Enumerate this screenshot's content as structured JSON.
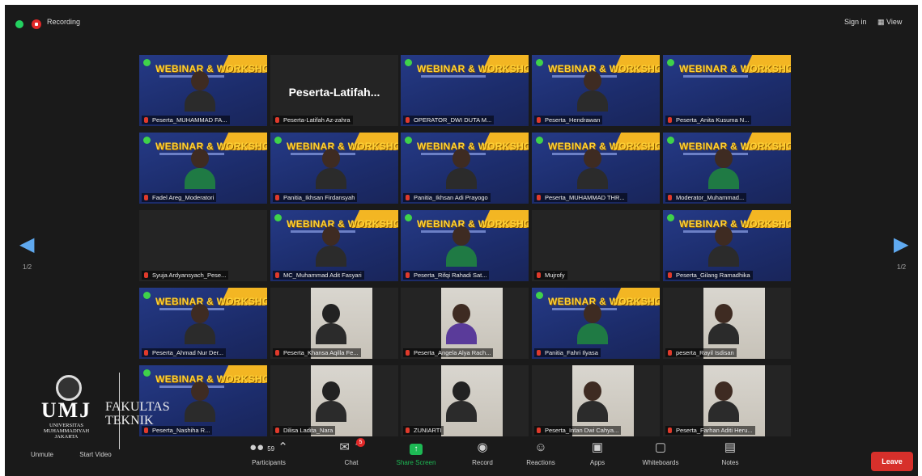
{
  "topbar": {
    "recording_label": "Recording",
    "sign_in": "Sign in",
    "view": "View"
  },
  "webinar_banner": "WEBINAR & WORKSHOP",
  "tiles": [
    {
      "name": "Peserta_MUHAMMAD FA...",
      "type": "webinar",
      "shirt": "dark"
    },
    {
      "name": "Peserta-Latifah Az-zahra",
      "type": "name",
      "big": "Peserta-Latifah..."
    },
    {
      "name": "OPERATOR_DWI DUTA M...",
      "type": "webinar",
      "shirt": "none"
    },
    {
      "name": "Peserta_Hendrawan",
      "type": "webinar",
      "shirt": "dark"
    },
    {
      "name": "Peserta_Anita Kusuma N...",
      "type": "webinar",
      "shirt": "none"
    },
    {
      "name": "Fadel Areg_Moderatori",
      "type": "webinar",
      "shirt": "green"
    },
    {
      "name": "Panitia_Ikhsan Firdansyah",
      "type": "webinar",
      "shirt": "dark"
    },
    {
      "name": "Panitia_Ikhsan Adi Prayogo",
      "type": "webinar",
      "shirt": "dark"
    },
    {
      "name": "Peserta_MUHAMMAD THR...",
      "type": "webinar",
      "shirt": "dark"
    },
    {
      "name": "Moderator_Muhammad...",
      "type": "webinar",
      "shirt": "green"
    },
    {
      "name": "Syuja Ardyansyach_Pese...",
      "type": "empty"
    },
    {
      "name": "MC_Muhammad Adit Fasyari",
      "type": "webinar",
      "shirt": "dark",
      "active": true
    },
    {
      "name": "Peserta_Rifqi Rahadi Sat...",
      "type": "webinar",
      "shirt": "green"
    },
    {
      "name": "Mujrofy",
      "type": "empty"
    },
    {
      "name": "Peserta_Gilang Ramadhika",
      "type": "webinar",
      "shirt": "dark"
    },
    {
      "name": "Peserta_Ahmad Nur Der...",
      "type": "webinar",
      "shirt": "dark"
    },
    {
      "name": "Peserta_Khansa Aqilla Fe...",
      "type": "camera",
      "shirt": "hijab"
    },
    {
      "name": "Peserta_Angela Alya Rach...",
      "type": "camera",
      "shirt": "purple"
    },
    {
      "name": "Panitia_Fahri Ilyasa",
      "type": "webinar",
      "shirt": "green"
    },
    {
      "name": "peserta_Rayil Isdisan",
      "type": "camera",
      "shirt": "dark"
    },
    {
      "name": "Peserta_Nashiha R...",
      "type": "webinar",
      "shirt": "dark"
    },
    {
      "name": "Dilisa Ladita_Nara",
      "type": "camera",
      "shirt": "hijab"
    },
    {
      "name": "ZUNIARTI",
      "type": "camera",
      "shirt": "hijab"
    },
    {
      "name": "Peserta_Intan Dwi Cahya...",
      "type": "camera",
      "shirt": "dark"
    },
    {
      "name": "Peserta_Farhan Aditi Heru...",
      "type": "camera",
      "shirt": "dark"
    }
  ],
  "pager": {
    "left": "1/2",
    "right": "1/2"
  },
  "logo": {
    "umj": "UMJ",
    "univ": "UNIVERSITAS MUHAMMADIYAH JAKARTA",
    "fakultas": "FAKULTAS",
    "teknik": "TEKNIK"
  },
  "toolbar": {
    "unmute": "Unmute",
    "start_video": "Start Video",
    "participants": "Participants",
    "participant_count": "59",
    "chat": "Chat",
    "chat_badge": "5",
    "share_screen": "Share Screen",
    "record": "Record",
    "reactions": "Reactions",
    "apps": "Apps",
    "whiteboards": "Whiteboards",
    "notes": "Notes",
    "leave": "Leave"
  }
}
